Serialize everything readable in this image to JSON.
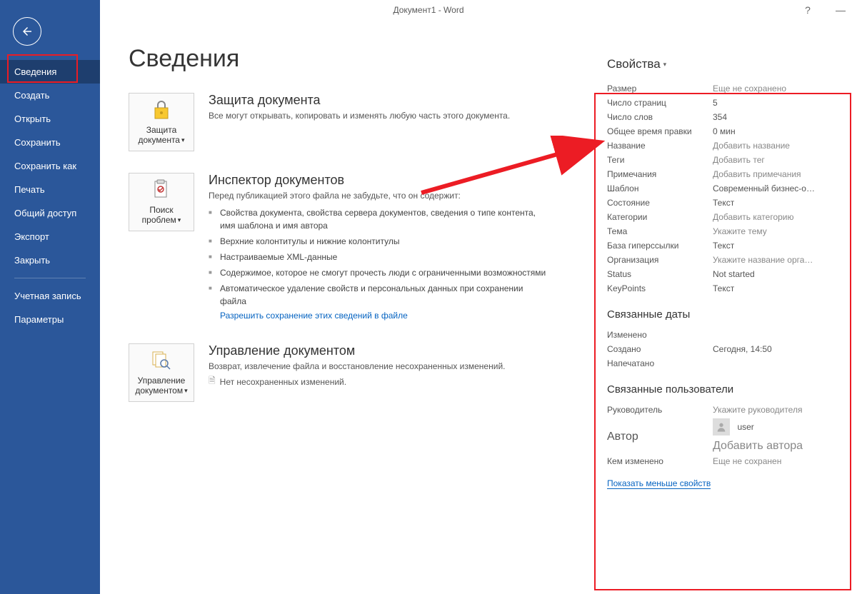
{
  "titlebar": {
    "title": "Документ1 - Word",
    "help": "?",
    "minimize": "—"
  },
  "sidebar": {
    "items": [
      {
        "label": "Сведения",
        "selected": true
      },
      {
        "label": "Создать"
      },
      {
        "label": "Открыть"
      },
      {
        "label": "Сохранить"
      },
      {
        "label": "Сохранить как"
      },
      {
        "label": "Печать"
      },
      {
        "label": "Общий доступ"
      },
      {
        "label": "Экспорт"
      },
      {
        "label": "Закрыть"
      }
    ],
    "footer": [
      {
        "label": "Учетная запись"
      },
      {
        "label": "Параметры"
      }
    ]
  },
  "page": {
    "title": "Сведения"
  },
  "sections": {
    "protect": {
      "btn": "Защита документа",
      "title": "Защита документа",
      "desc": "Все могут открывать, копировать и изменять любую часть этого документа."
    },
    "inspect": {
      "btn": "Поиск проблем",
      "title": "Инспектор документов",
      "desc": "Перед публикацией этого файла не забудьте, что он содержит:",
      "items": [
        "Свойства документа, свойства сервера документов, сведения о типе контента, имя шаблона и имя автора",
        "Верхние колонтитулы и нижние колонтитулы",
        "Настраиваемые XML-данные",
        "Содержимое, которое не смогут прочесть люди с ограниченными возможностями",
        "Автоматическое удаление свойств и персональных данных при сохранении файла"
      ],
      "link": "Разрешить сохранение этих сведений в файле"
    },
    "manage": {
      "btn": "Управление документом",
      "title": "Управление документом",
      "desc": "Возврат, извлечение файла и восстановление несохраненных изменений.",
      "unsaved": "Нет несохраненных изменений."
    }
  },
  "properties": {
    "header": "Свойства",
    "rows": [
      {
        "label": "Размер",
        "value": "Еще не сохранено",
        "placeholder": true
      },
      {
        "label": "Число страниц",
        "value": "5"
      },
      {
        "label": "Число слов",
        "value": "354"
      },
      {
        "label": "Общее время правки",
        "value": "0 мин"
      },
      {
        "label": "Название",
        "value": "Добавить название",
        "placeholder": true
      },
      {
        "label": "Теги",
        "value": "Добавить тег",
        "placeholder": true
      },
      {
        "label": "Примечания",
        "value": "Добавить примечания",
        "placeholder": true
      },
      {
        "label": "Шаблон",
        "value": "Современный бизнес-о…"
      },
      {
        "label": "Состояние",
        "value": "Текст"
      },
      {
        "label": "Категории",
        "value": "Добавить категорию",
        "placeholder": true
      },
      {
        "label": "Тема",
        "value": "Укажите тему",
        "placeholder": true
      },
      {
        "label": "База гиперссылки",
        "value": "Текст"
      },
      {
        "label": "Организация",
        "value": "Укажите название орга…",
        "placeholder": true
      },
      {
        "label": "Status",
        "value": "Not started"
      },
      {
        "label": "KeyPoints",
        "value": "Текст"
      }
    ],
    "dates": {
      "header": "Связанные даты",
      "rows": [
        {
          "label": "Изменено",
          "value": ""
        },
        {
          "label": "Создано",
          "value": "Сегодня, 14:50"
        },
        {
          "label": "Напечатано",
          "value": ""
        }
      ]
    },
    "users": {
      "header": "Связанные пользователи",
      "manager_label": "Руководитель",
      "manager_value": "Укажите руководителя",
      "author_label": "Автор",
      "author_name": "user",
      "add_author": "Добавить автора",
      "changed_by_label": "Кем изменено",
      "changed_by_value": "Еще не сохранен"
    },
    "show_less": "Показать меньше свойств"
  }
}
